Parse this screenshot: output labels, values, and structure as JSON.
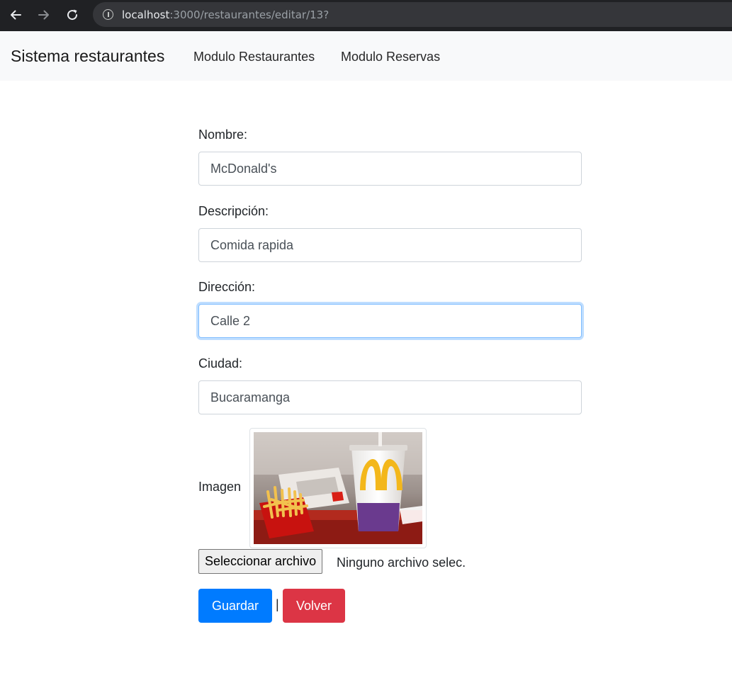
{
  "browser": {
    "url_host": "localhost",
    "url_path": ":3000/restaurantes/editar/13?",
    "back_icon": "arrow-left",
    "forward_icon": "arrow-right",
    "reload_icon": "reload"
  },
  "navbar": {
    "brand": "Sistema restaurantes",
    "links": [
      {
        "label": "Modulo Restaurantes"
      },
      {
        "label": "Modulo Reservas"
      }
    ],
    "background": "#f8f9fa"
  },
  "form": {
    "fields": [
      {
        "label": "Nombre:",
        "value": "McDonald's"
      },
      {
        "label": "Descripción:",
        "value": "Comida rapida"
      },
      {
        "label": "Dirección:",
        "value": "Calle 2"
      },
      {
        "label": "Ciudad:",
        "value": "Bucaramanga"
      }
    ],
    "image_label": "Imagen",
    "file_button": "Seleccionar archivo",
    "file_status": "Ninguno archivo selec.",
    "save_button": "Guardar",
    "separator": "|",
    "back_button": "Volver"
  },
  "colors": {
    "primary": "#007bff",
    "danger": "#dc3545",
    "focus_border": "#80bdff"
  }
}
